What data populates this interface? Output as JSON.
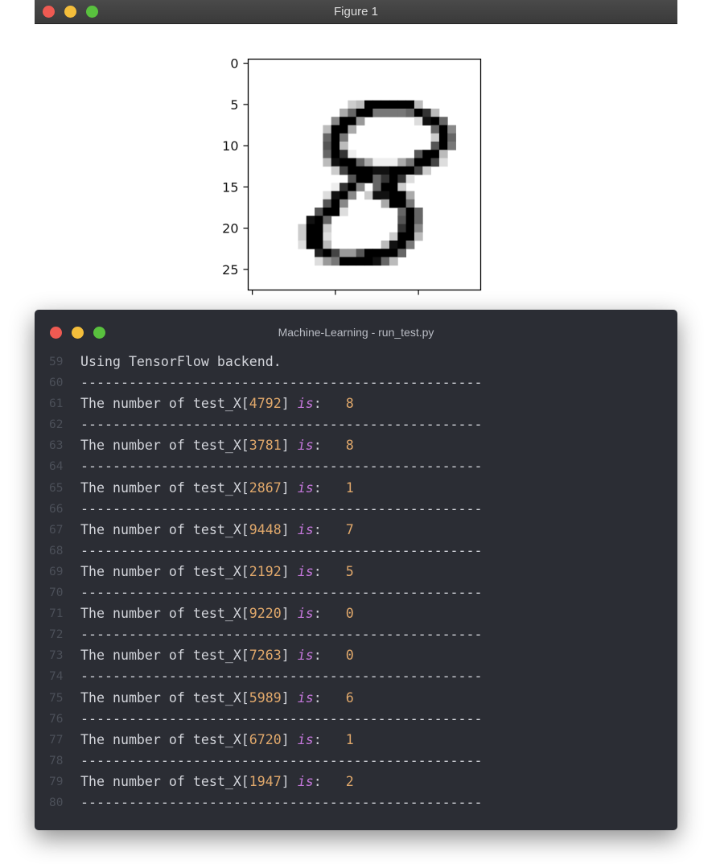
{
  "figure_window": {
    "title": "Figure 1",
    "traffic_lights": {
      "close": "#ee5a52",
      "minimize": "#f4be3b",
      "zoom": "#59c13e"
    }
  },
  "image_plot": {
    "y_ticks": [
      "0",
      "5",
      "10",
      "15",
      "20",
      "25"
    ],
    "image_size": 28,
    "colormap": "gray_r",
    "depicted_digit": "8"
  },
  "terminal": {
    "title": "Machine-Learning - run_test.py",
    "traffic_lights": {
      "close": "#ee5a52",
      "minimize": "#f4be3b",
      "zoom": "#59c13e"
    },
    "lines": [
      {
        "n": "59",
        "kind": "text",
        "text": "Using TensorFlow backend."
      },
      {
        "n": "60",
        "kind": "sep",
        "text": "--------------------------------------------------"
      },
      {
        "n": "61",
        "kind": "result",
        "prefix": "The number of test_X[",
        "index": "4792",
        "mid": "]",
        "kw": "is",
        "colon": ":",
        "value": "8"
      },
      {
        "n": "62",
        "kind": "sep",
        "text": "--------------------------------------------------"
      },
      {
        "n": "63",
        "kind": "result",
        "prefix": "The number of test_X[",
        "index": "3781",
        "mid": "]",
        "kw": "is",
        "colon": ":",
        "value": "8"
      },
      {
        "n": "64",
        "kind": "sep",
        "text": "--------------------------------------------------"
      },
      {
        "n": "65",
        "kind": "result",
        "prefix": "The number of test_X[",
        "index": "2867",
        "mid": "]",
        "kw": "is",
        "colon": ":",
        "value": "1"
      },
      {
        "n": "66",
        "kind": "sep",
        "text": "--------------------------------------------------"
      },
      {
        "n": "67",
        "kind": "result",
        "prefix": "The number of test_X[",
        "index": "9448",
        "mid": "]",
        "kw": "is",
        "colon": ":",
        "value": "7"
      },
      {
        "n": "68",
        "kind": "sep",
        "text": "--------------------------------------------------"
      },
      {
        "n": "69",
        "kind": "result",
        "prefix": "The number of test_X[",
        "index": "2192",
        "mid": "]",
        "kw": "is",
        "colon": ":",
        "value": "5"
      },
      {
        "n": "70",
        "kind": "sep",
        "text": "--------------------------------------------------"
      },
      {
        "n": "71",
        "kind": "result",
        "prefix": "The number of test_X[",
        "index": "9220",
        "mid": "]",
        "kw": "is",
        "colon": ":",
        "value": "0"
      },
      {
        "n": "72",
        "kind": "sep",
        "text": "--------------------------------------------------"
      },
      {
        "n": "73",
        "kind": "result",
        "prefix": "The number of test_X[",
        "index": "7263",
        "mid": "]",
        "kw": "is",
        "colon": ":",
        "value": "0"
      },
      {
        "n": "74",
        "kind": "sep",
        "text": "--------------------------------------------------"
      },
      {
        "n": "75",
        "kind": "result",
        "prefix": "The number of test_X[",
        "index": "5989",
        "mid": "]",
        "kw": "is",
        "colon": ":",
        "value": "6"
      },
      {
        "n": "76",
        "kind": "sep",
        "text": "--------------------------------------------------"
      },
      {
        "n": "77",
        "kind": "result",
        "prefix": "The number of test_X[",
        "index": "6720",
        "mid": "]",
        "kw": "is",
        "colon": ":",
        "value": "1"
      },
      {
        "n": "78",
        "kind": "sep",
        "text": "--------------------------------------------------"
      },
      {
        "n": "79",
        "kind": "result",
        "prefix": "The number of test_X[",
        "index": "1947",
        "mid": "]",
        "kw": "is",
        "colon": ":",
        "value": "2"
      },
      {
        "n": "80",
        "kind": "sep",
        "text": "--------------------------------------------------"
      }
    ]
  }
}
